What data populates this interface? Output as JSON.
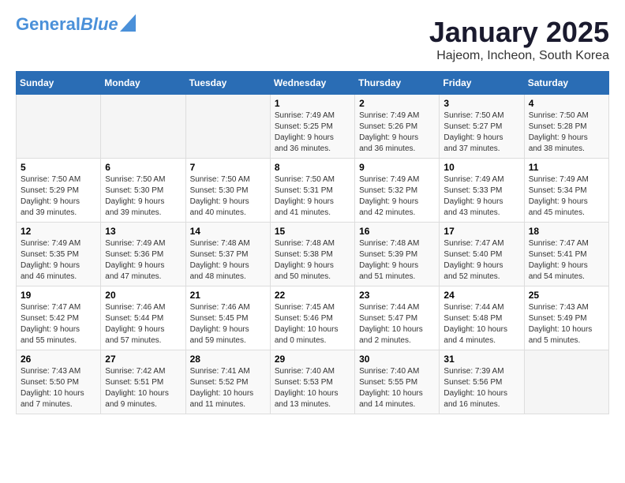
{
  "logo": {
    "line1": "General",
    "line2": "Blue"
  },
  "title": "January 2025",
  "subtitle": "Hajeom, Incheon, South Korea",
  "days_of_week": [
    "Sunday",
    "Monday",
    "Tuesday",
    "Wednesday",
    "Thursday",
    "Friday",
    "Saturday"
  ],
  "weeks": [
    [
      {
        "day": "",
        "content": ""
      },
      {
        "day": "",
        "content": ""
      },
      {
        "day": "",
        "content": ""
      },
      {
        "day": "1",
        "content": "Sunrise: 7:49 AM\nSunset: 5:25 PM\nDaylight: 9 hours\nand 36 minutes."
      },
      {
        "day": "2",
        "content": "Sunrise: 7:49 AM\nSunset: 5:26 PM\nDaylight: 9 hours\nand 36 minutes."
      },
      {
        "day": "3",
        "content": "Sunrise: 7:50 AM\nSunset: 5:27 PM\nDaylight: 9 hours\nand 37 minutes."
      },
      {
        "day": "4",
        "content": "Sunrise: 7:50 AM\nSunset: 5:28 PM\nDaylight: 9 hours\nand 38 minutes."
      }
    ],
    [
      {
        "day": "5",
        "content": "Sunrise: 7:50 AM\nSunset: 5:29 PM\nDaylight: 9 hours\nand 39 minutes."
      },
      {
        "day": "6",
        "content": "Sunrise: 7:50 AM\nSunset: 5:30 PM\nDaylight: 9 hours\nand 39 minutes."
      },
      {
        "day": "7",
        "content": "Sunrise: 7:50 AM\nSunset: 5:30 PM\nDaylight: 9 hours\nand 40 minutes."
      },
      {
        "day": "8",
        "content": "Sunrise: 7:50 AM\nSunset: 5:31 PM\nDaylight: 9 hours\nand 41 minutes."
      },
      {
        "day": "9",
        "content": "Sunrise: 7:49 AM\nSunset: 5:32 PM\nDaylight: 9 hours\nand 42 minutes."
      },
      {
        "day": "10",
        "content": "Sunrise: 7:49 AM\nSunset: 5:33 PM\nDaylight: 9 hours\nand 43 minutes."
      },
      {
        "day": "11",
        "content": "Sunrise: 7:49 AM\nSunset: 5:34 PM\nDaylight: 9 hours\nand 45 minutes."
      }
    ],
    [
      {
        "day": "12",
        "content": "Sunrise: 7:49 AM\nSunset: 5:35 PM\nDaylight: 9 hours\nand 46 minutes."
      },
      {
        "day": "13",
        "content": "Sunrise: 7:49 AM\nSunset: 5:36 PM\nDaylight: 9 hours\nand 47 minutes."
      },
      {
        "day": "14",
        "content": "Sunrise: 7:48 AM\nSunset: 5:37 PM\nDaylight: 9 hours\nand 48 minutes."
      },
      {
        "day": "15",
        "content": "Sunrise: 7:48 AM\nSunset: 5:38 PM\nDaylight: 9 hours\nand 50 minutes."
      },
      {
        "day": "16",
        "content": "Sunrise: 7:48 AM\nSunset: 5:39 PM\nDaylight: 9 hours\nand 51 minutes."
      },
      {
        "day": "17",
        "content": "Sunrise: 7:47 AM\nSunset: 5:40 PM\nDaylight: 9 hours\nand 52 minutes."
      },
      {
        "day": "18",
        "content": "Sunrise: 7:47 AM\nSunset: 5:41 PM\nDaylight: 9 hours\nand 54 minutes."
      }
    ],
    [
      {
        "day": "19",
        "content": "Sunrise: 7:47 AM\nSunset: 5:42 PM\nDaylight: 9 hours\nand 55 minutes."
      },
      {
        "day": "20",
        "content": "Sunrise: 7:46 AM\nSunset: 5:44 PM\nDaylight: 9 hours\nand 57 minutes."
      },
      {
        "day": "21",
        "content": "Sunrise: 7:46 AM\nSunset: 5:45 PM\nDaylight: 9 hours\nand 59 minutes."
      },
      {
        "day": "22",
        "content": "Sunrise: 7:45 AM\nSunset: 5:46 PM\nDaylight: 10 hours\nand 0 minutes."
      },
      {
        "day": "23",
        "content": "Sunrise: 7:44 AM\nSunset: 5:47 PM\nDaylight: 10 hours\nand 2 minutes."
      },
      {
        "day": "24",
        "content": "Sunrise: 7:44 AM\nSunset: 5:48 PM\nDaylight: 10 hours\nand 4 minutes."
      },
      {
        "day": "25",
        "content": "Sunrise: 7:43 AM\nSunset: 5:49 PM\nDaylight: 10 hours\nand 5 minutes."
      }
    ],
    [
      {
        "day": "26",
        "content": "Sunrise: 7:43 AM\nSunset: 5:50 PM\nDaylight: 10 hours\nand 7 minutes."
      },
      {
        "day": "27",
        "content": "Sunrise: 7:42 AM\nSunset: 5:51 PM\nDaylight: 10 hours\nand 9 minutes."
      },
      {
        "day": "28",
        "content": "Sunrise: 7:41 AM\nSunset: 5:52 PM\nDaylight: 10 hours\nand 11 minutes."
      },
      {
        "day": "29",
        "content": "Sunrise: 7:40 AM\nSunset: 5:53 PM\nDaylight: 10 hours\nand 13 minutes."
      },
      {
        "day": "30",
        "content": "Sunrise: 7:40 AM\nSunset: 5:55 PM\nDaylight: 10 hours\nand 14 minutes."
      },
      {
        "day": "31",
        "content": "Sunrise: 7:39 AM\nSunset: 5:56 PM\nDaylight: 10 hours\nand 16 minutes."
      },
      {
        "day": "",
        "content": ""
      }
    ]
  ]
}
